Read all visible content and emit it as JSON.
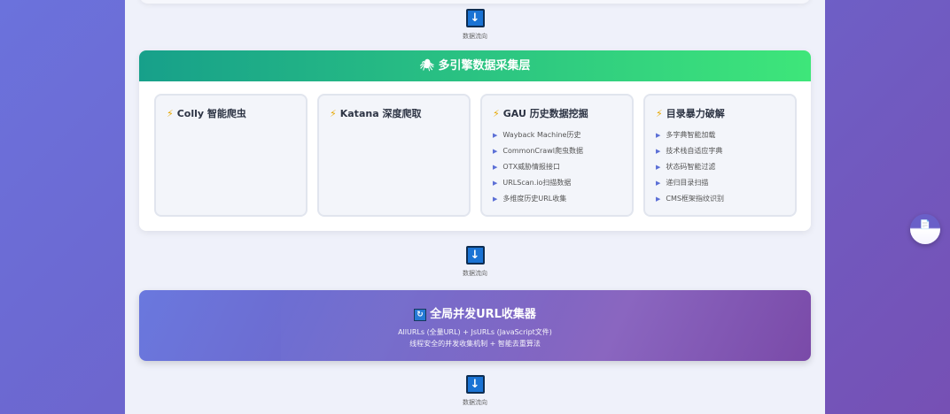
{
  "flow_label": "数据流向",
  "layer": {
    "icon": "🕷",
    "title": "多引擎数据采集层",
    "cards": [
      {
        "title": "Colly 智能爬虫",
        "items": []
      },
      {
        "title": "Katana 深度爬取",
        "items": []
      },
      {
        "title": "GAU 历史数据挖掘",
        "items": [
          "Wayback Machine历史",
          "CommonCrawl爬虫数据",
          "OTX威胁情报接口",
          "URLScan.io扫描数据",
          "多维度历史URL收集"
        ]
      },
      {
        "title": "目录暴力破解",
        "items": [
          "多字典智能加载",
          "技术栈自适应字典",
          "状态码智能过滤",
          "递归目录扫描",
          "CMS框架指纹识别"
        ]
      }
    ]
  },
  "collector": {
    "title": "全局并发URL收集器",
    "line1": "AllURLs (全量URL) + JsURLs (JavaScript文件)",
    "line2": "线程安全的并发收集机制 + 智能去重算法"
  },
  "colors": {
    "header_start": "#17a08a",
    "header_end": "#3ee67a",
    "accent": "#1a73d4"
  }
}
